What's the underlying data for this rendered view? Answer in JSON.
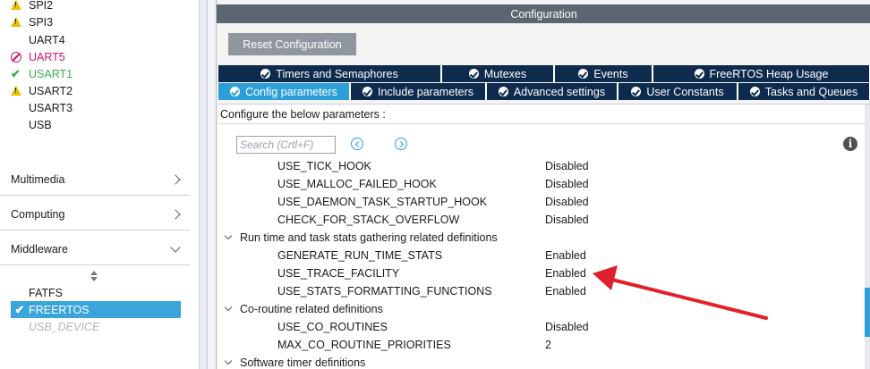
{
  "peripherals": [
    {
      "label": "SPI2",
      "status": "warning"
    },
    {
      "label": "SPI3",
      "status": "warning"
    },
    {
      "label": "UART4",
      "status": "none"
    },
    {
      "label": "UART5",
      "status": "disabled"
    },
    {
      "label": "USART1",
      "status": "ok"
    },
    {
      "label": "USART2",
      "status": "warning"
    },
    {
      "label": "USART3",
      "status": "none"
    },
    {
      "label": "USB",
      "status": "none"
    }
  ],
  "categories": [
    {
      "label": "Multimedia",
      "expanded": false
    },
    {
      "label": "Computing",
      "expanded": false
    },
    {
      "label": "Middleware",
      "expanded": true
    }
  ],
  "middleware_items": [
    {
      "label": "FATFS",
      "state": "normal"
    },
    {
      "label": "FREERTOS",
      "state": "selected"
    },
    {
      "label": "USB_DEVICE",
      "state": "disabled"
    }
  ],
  "config": {
    "header": "Configuration",
    "reset_label": "Reset Configuration",
    "tabs_row1": [
      {
        "label": "Timers and Semaphores"
      },
      {
        "label": "Mutexes"
      },
      {
        "label": "Events"
      },
      {
        "label": "FreeRTOS Heap Usage"
      }
    ],
    "tabs_row2": [
      {
        "label": "Config parameters",
        "active": true
      },
      {
        "label": "Include parameters"
      },
      {
        "label": "Advanced settings"
      },
      {
        "label": "User Constants"
      },
      {
        "label": "Tasks and Queues"
      }
    ],
    "hint": "Configure the below parameters :",
    "search_placeholder": "Search (Crtl+F)",
    "rows": [
      {
        "type": "param",
        "name": "USE_TICK_HOOK",
        "value": "Disabled"
      },
      {
        "type": "param",
        "name": "USE_MALLOC_FAILED_HOOK",
        "value": "Disabled"
      },
      {
        "type": "param",
        "name": "USE_DAEMON_TASK_STARTUP_HOOK",
        "value": "Disabled"
      },
      {
        "type": "param",
        "name": "CHECK_FOR_STACK_OVERFLOW",
        "value": "Disabled"
      },
      {
        "type": "group",
        "name": "Run time and task stats gathering related definitions"
      },
      {
        "type": "param",
        "name": "GENERATE_RUN_TIME_STATS",
        "value": "Enabled"
      },
      {
        "type": "param",
        "name": "USE_TRACE_FACILITY",
        "value": "Enabled"
      },
      {
        "type": "param",
        "name": "USE_STATS_FORMATTING_FUNCTIONS",
        "value": "Enabled"
      },
      {
        "type": "group",
        "name": "Co-routine related definitions"
      },
      {
        "type": "param",
        "name": "USE_CO_ROUTINES",
        "value": "Disabled"
      },
      {
        "type": "param",
        "name": "MAX_CO_ROUTINE_PRIORITIES",
        "value": "2"
      },
      {
        "type": "group",
        "name": "Software timer definitions"
      }
    ]
  },
  "colors": {
    "accent_blue": "#2d9fd8",
    "tab_dark": "#0e2b4e",
    "header_gray": "#5b6670",
    "annotation_arrow": "#e0202a"
  }
}
